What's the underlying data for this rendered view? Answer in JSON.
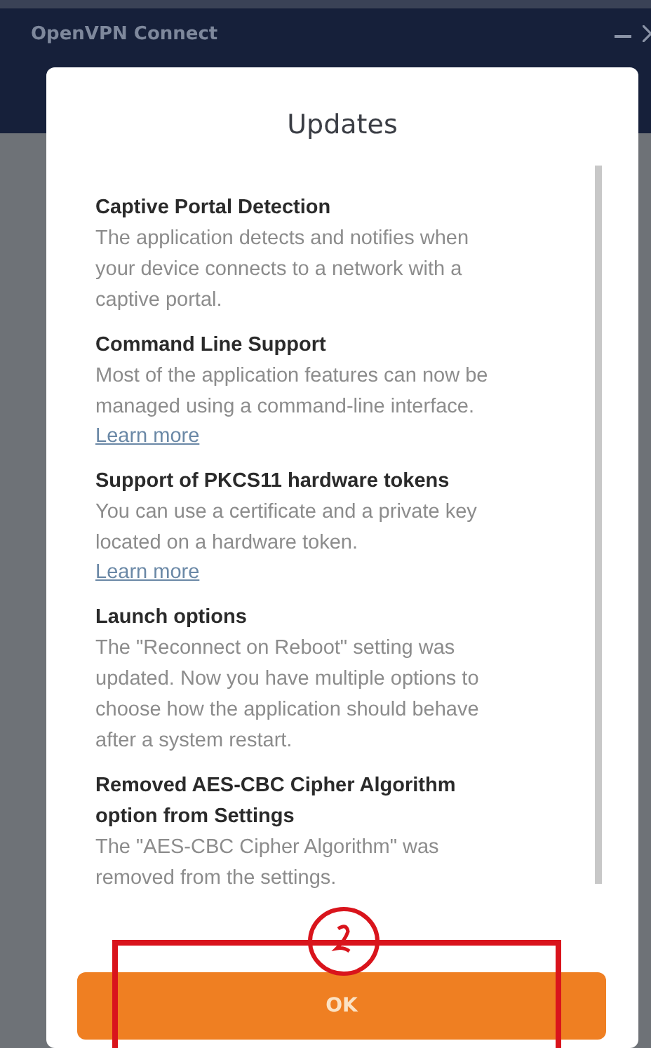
{
  "window": {
    "title": "OpenVPN Connect"
  },
  "dialog": {
    "title": "Updates",
    "sections": [
      {
        "heading": "Captive Portal Detection",
        "body": "The application detects and notifies when your device connects to a network with a captive portal."
      },
      {
        "heading": "Command Line Support",
        "body": "Most of the application features can now be managed using a command-line interface.",
        "link": "Learn more"
      },
      {
        "heading": "Support of PKCS11 hardware tokens",
        "body": "You can use a certificate and a private key located on a hardware token.",
        "link": "Learn more"
      },
      {
        "heading": "Launch options",
        "body": "The \"Reconnect on Reboot\" setting was updated. Now you have multiple options to choose how the application should behave after a system restart."
      },
      {
        "heading": "Removed AES-CBC Cipher Algorithm option from Settings",
        "body": "The \"AES-CBC Cipher Algorithm\" was removed from the settings."
      }
    ],
    "button": "OK"
  },
  "annotations": [
    {
      "kind": "ellipse"
    },
    {
      "kind": "rectangle"
    }
  ]
}
